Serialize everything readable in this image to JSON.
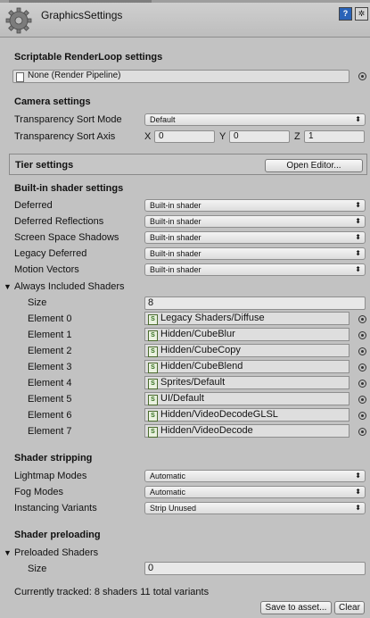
{
  "window": {
    "title": "GraphicsSettings"
  },
  "render_loop": {
    "heading": "Scriptable RenderLoop settings",
    "pipeline_value": "None (Render Pipeline)"
  },
  "camera": {
    "heading": "Camera settings",
    "sort_mode_label": "Transparency Sort Mode",
    "sort_mode_value": "Default",
    "sort_axis_label": "Transparency Sort Axis",
    "x_label": "X",
    "x_value": "0",
    "y_label": "Y",
    "y_value": "0",
    "z_label": "Z",
    "z_value": "1"
  },
  "tier": {
    "heading": "Tier settings",
    "open_editor_label": "Open Editor..."
  },
  "builtin": {
    "heading": "Built-in shader settings",
    "rows": [
      {
        "label": "Deferred",
        "value": "Built-in shader"
      },
      {
        "label": "Deferred Reflections",
        "value": "Built-in shader"
      },
      {
        "label": "Screen Space Shadows",
        "value": "Built-in shader"
      },
      {
        "label": "Legacy Deferred",
        "value": "Built-in shader"
      },
      {
        "label": "Motion Vectors",
        "value": "Built-in shader"
      }
    ]
  },
  "always_included": {
    "heading": "Always Included Shaders",
    "size_label": "Size",
    "size_value": "8",
    "elements": [
      {
        "label": "Element 0",
        "value": "Legacy Shaders/Diffuse"
      },
      {
        "label": "Element 1",
        "value": "Hidden/CubeBlur"
      },
      {
        "label": "Element 2",
        "value": "Hidden/CubeCopy"
      },
      {
        "label": "Element 3",
        "value": "Hidden/CubeBlend"
      },
      {
        "label": "Element 4",
        "value": "Sprites/Default"
      },
      {
        "label": "Element 5",
        "value": "UI/Default"
      },
      {
        "label": "Element 6",
        "value": "Hidden/VideoDecodeGLSL"
      },
      {
        "label": "Element 7",
        "value": "Hidden/VideoDecode"
      }
    ]
  },
  "stripping": {
    "heading": "Shader stripping",
    "rows": [
      {
        "label": "Lightmap Modes",
        "value": "Automatic"
      },
      {
        "label": "Fog Modes",
        "value": "Automatic"
      },
      {
        "label": "Instancing Variants",
        "value": "Strip Unused"
      }
    ]
  },
  "preloading": {
    "heading": "Shader preloading",
    "preloaded_label": "Preloaded Shaders",
    "size_label": "Size",
    "size_value": "0",
    "tracked_text": "Currently tracked: 8 shaders 11 total variants",
    "save_label": "Save to asset...",
    "clear_label": "Clear"
  }
}
